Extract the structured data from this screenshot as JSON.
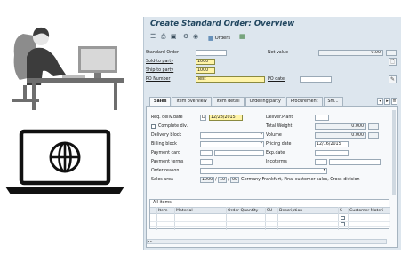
{
  "window": {
    "title": "Create Standard Order: Overview"
  },
  "toolbar": {
    "orders_label": "Orders"
  },
  "header": {
    "standard_order_label": "Standard Order",
    "net_value_label": "Net value",
    "net_value": "0.00",
    "sold_to_label": "Sold-to party",
    "sold_to_value": "1000",
    "ship_to_label": "Ship-to party",
    "ship_to_value": "1000",
    "po_number_label": "PO Number",
    "po_number_value": "Test",
    "po_date_label": "PO date"
  },
  "tabs": [
    "Sales",
    "Item overview",
    "Item detail",
    "Ordering party",
    "Procurement",
    "Shi..."
  ],
  "sales": {
    "req_deliv_date_label": "Req. deliv.date",
    "req_deliv_date_type": "D",
    "req_deliv_date": "12/28/2015",
    "deliver_plant_label": "Deliver.Plant",
    "complete_div_label": "Complete div.",
    "total_weight_label": "Total Weight",
    "total_weight": "0.000",
    "delivery_block_label": "Delivery block",
    "volume_label": "Volume",
    "volume": "0.000",
    "billing_block_label": "Billing block",
    "pricing_date_label": "Pricing date",
    "pricing_date": "12/16/2015",
    "payment_card_label": "Payment card",
    "exp_date_label": "Exp.date",
    "payment_terms_label": "Payment terms",
    "incoterms_label": "Incoterms",
    "order_reason_label": "Order reason",
    "sales_area_label": "Sales area",
    "sales_area_org": "1000",
    "sales_area_channel": "10",
    "sales_area_division": "00",
    "sales_area_text": "Germany Frankfurt, Final customer sales, Cross-division"
  },
  "items": {
    "title": "All items",
    "columns": [
      "Item",
      "Material",
      "Order Quantity",
      "SU",
      "Description",
      "S",
      "Customer Materi"
    ]
  },
  "colors": {
    "window_bg": "#dde6ee",
    "title": "#21465f",
    "required_field": "#fff4a8"
  },
  "icons": [
    "save-icon",
    "back-icon",
    "print-icon",
    "settings-icon",
    "orders-icon",
    "grid-icon",
    "document-icon"
  ]
}
